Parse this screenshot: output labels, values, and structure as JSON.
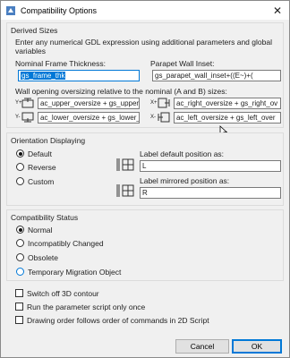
{
  "window": {
    "title": "Compatibility Options"
  },
  "derived": {
    "title": "Derived Sizes",
    "description": "Enter any numerical GDL expression using additional parameters and global variables",
    "frame_label": "Nominal Frame Thickness:",
    "frame_value": "gs_frame_thk",
    "parapet_label": "Parapet Wall Inset:",
    "parapet_value": "gs_parapet_wall_inset+((E~)+(",
    "opening_label": "Wall opening oversizing relative to the nominal (A and B) sizes:",
    "upper_value": "ac_upper_oversize + gs_upper_",
    "lower_value": "ac_lower_oversize + gs_lower_",
    "right_value": "ac_right_oversize + gs_right_ov",
    "left_value": "ac_left_oversize + gs_left_over",
    "y_plus": "Y+",
    "y_minus": "Y-",
    "x_plus": "X+",
    "x_minus": "X-"
  },
  "orientation": {
    "title": "Orientation Displaying",
    "options": [
      "Default",
      "Reverse",
      "Custom"
    ],
    "selected": "Default",
    "label_default_title": "Label default position as:",
    "label_default_value": "L",
    "label_mirrored_title": "Label mirrored position as:",
    "label_mirrored_value": "R"
  },
  "status": {
    "title": "Compatibility Status",
    "options": [
      "Normal",
      "Incompatibly Changed",
      "Obsolete",
      "Temporary Migration Object"
    ],
    "selected": "Normal"
  },
  "checkboxes": [
    "Switch off 3D contour",
    "Run the parameter script only once",
    "Drawing order follows order of commands in 2D Script"
  ],
  "buttons": {
    "cancel": "Cancel",
    "ok": "OK"
  },
  "colors": {
    "accent": "#0078d7",
    "background": "#f0f0f0"
  }
}
